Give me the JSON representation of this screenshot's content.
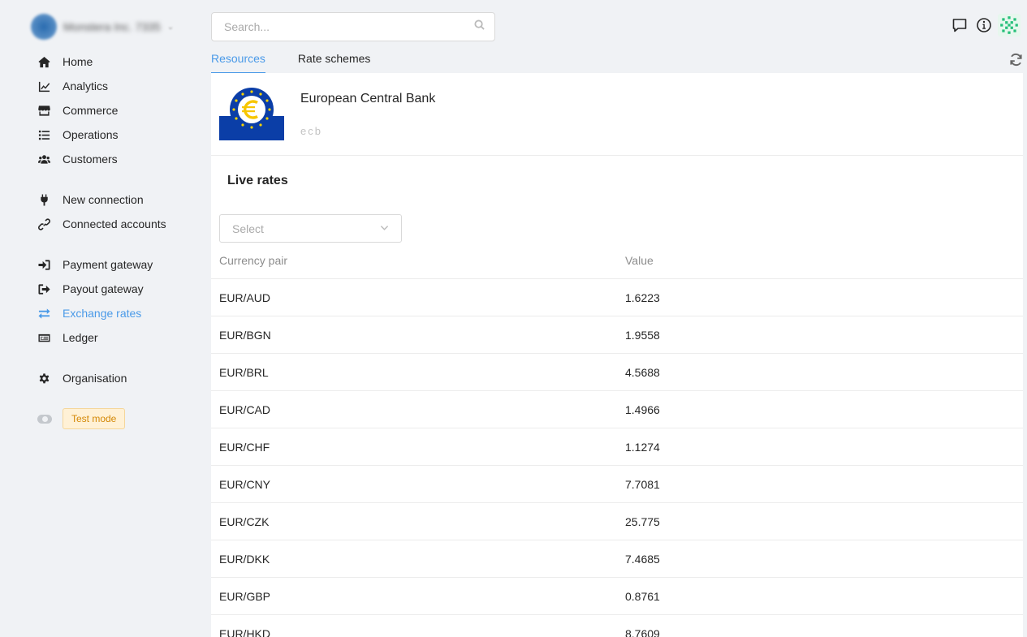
{
  "org": {
    "name": "Monstera Inc. 7335",
    "caret": "⌄"
  },
  "nav": {
    "group1": [
      {
        "label": "Home",
        "icon": "home-icon"
      },
      {
        "label": "Analytics",
        "icon": "chart-line-icon"
      },
      {
        "label": "Commerce",
        "icon": "store-icon"
      },
      {
        "label": "Operations",
        "icon": "list-icon"
      },
      {
        "label": "Customers",
        "icon": "users-icon"
      }
    ],
    "group2": [
      {
        "label": "New connection",
        "icon": "plug-icon"
      },
      {
        "label": "Connected accounts",
        "icon": "link-icon"
      }
    ],
    "group3": [
      {
        "label": "Payment gateway",
        "icon": "sign-in-icon"
      },
      {
        "label": "Payout gateway",
        "icon": "sign-out-icon"
      },
      {
        "label": "Exchange rates",
        "icon": "exchange-icon"
      },
      {
        "label": "Ledger",
        "icon": "money-check-icon"
      }
    ],
    "group4": [
      {
        "label": "Organisation",
        "icon": "gear-icon"
      }
    ],
    "test_mode_label": "Test mode"
  },
  "search": {
    "placeholder": "Search..."
  },
  "tabs": [
    {
      "label": "Resources",
      "active": true
    },
    {
      "label": "Rate schemes",
      "active": false
    }
  ],
  "provider": {
    "name": "European Central Bank",
    "code": "ecb"
  },
  "live_rates": {
    "title": "Live rates",
    "select_placeholder": "Select",
    "columns": [
      "Currency pair",
      "Value"
    ],
    "rows": [
      [
        "EUR/AUD",
        "1.6223"
      ],
      [
        "EUR/BGN",
        "1.9558"
      ],
      [
        "EUR/BRL",
        "4.5688"
      ],
      [
        "EUR/CAD",
        "1.4966"
      ],
      [
        "EUR/CHF",
        "1.1274"
      ],
      [
        "EUR/CNY",
        "7.7081"
      ],
      [
        "EUR/CZK",
        "25.775"
      ],
      [
        "EUR/DKK",
        "7.4685"
      ],
      [
        "EUR/GBP",
        "0.8761"
      ],
      [
        "EUR/HKD",
        "8.7609"
      ]
    ]
  },
  "colors": {
    "accent": "#4a9ae8",
    "background": "#f0f2f5",
    "test_badge": "#fff1d6"
  }
}
